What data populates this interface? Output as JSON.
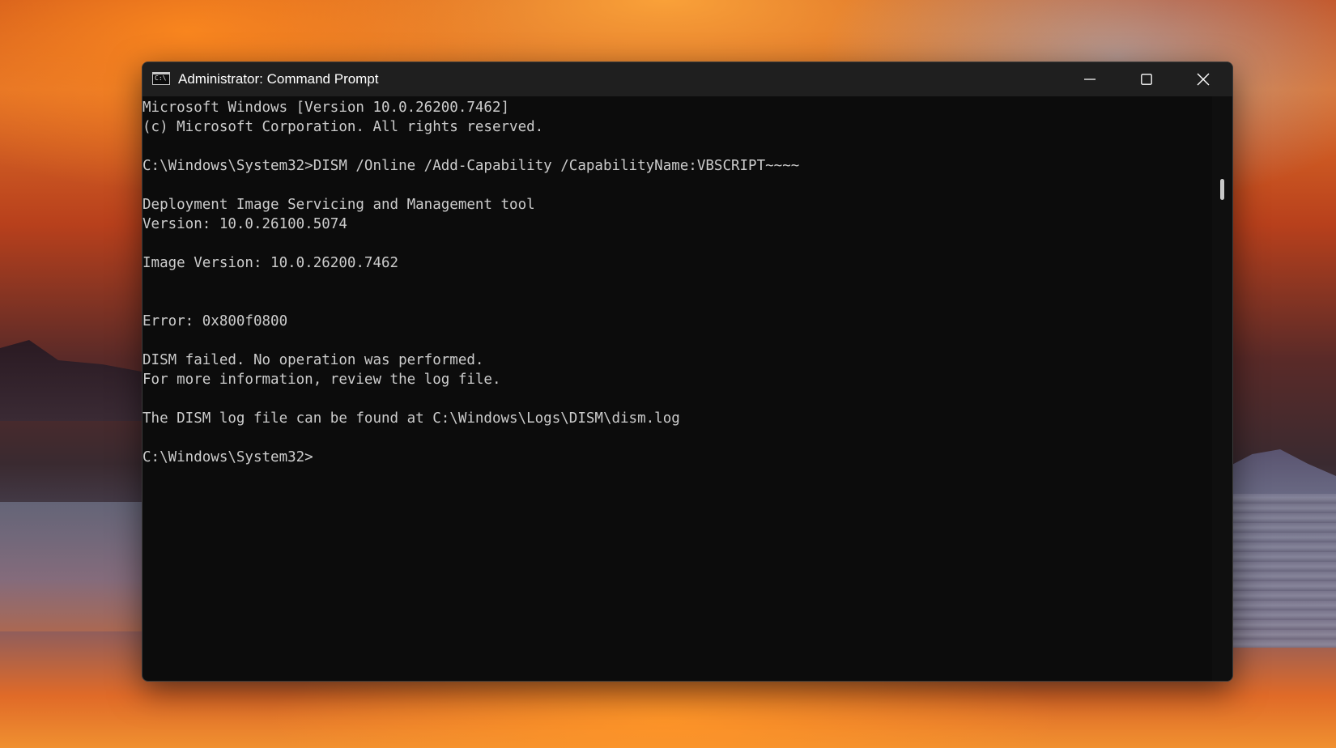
{
  "window": {
    "title": "Administrator: Command Prompt",
    "icon": "terminal-icon",
    "icon_text": "C:\\"
  },
  "controls": {
    "minimize_icon": "minimize-icon",
    "maximize_icon": "maximize-icon",
    "close_icon": "close-icon"
  },
  "console": {
    "text_color": "#cccccc",
    "background": "#0c0c0c",
    "lines": [
      "Microsoft Windows [Version 10.0.26200.7462]",
      "(c) Microsoft Corporation. All rights reserved.",
      "",
      "C:\\Windows\\System32>DISM /Online /Add-Capability /CapabilityName:VBSCRIPT~~~~",
      "",
      "Deployment Image Servicing and Management tool",
      "Version: 10.0.26100.5074",
      "",
      "Image Version: 10.0.26200.7462",
      "",
      "",
      "Error: 0x800f0800",
      "",
      "DISM failed. No operation was performed.",
      "For more information, review the log file.",
      "",
      "The DISM log file can be found at C:\\Windows\\Logs\\DISM\\dism.log",
      "",
      "C:\\Windows\\System32>"
    ]
  }
}
